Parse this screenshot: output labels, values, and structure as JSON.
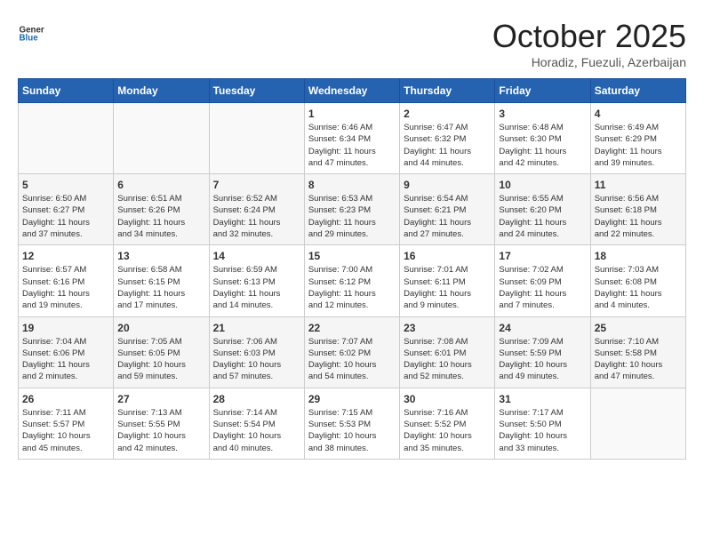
{
  "header": {
    "logo_line1": "General",
    "logo_line2": "Blue",
    "month": "October 2025",
    "location": "Horadiz, Fuezuli, Azerbaijan"
  },
  "weekdays": [
    "Sunday",
    "Monday",
    "Tuesday",
    "Wednesday",
    "Thursday",
    "Friday",
    "Saturday"
  ],
  "weeks": [
    [
      {
        "day": "",
        "info": ""
      },
      {
        "day": "",
        "info": ""
      },
      {
        "day": "",
        "info": ""
      },
      {
        "day": "1",
        "info": "Sunrise: 6:46 AM\nSunset: 6:34 PM\nDaylight: 11 hours\nand 47 minutes."
      },
      {
        "day": "2",
        "info": "Sunrise: 6:47 AM\nSunset: 6:32 PM\nDaylight: 11 hours\nand 44 minutes."
      },
      {
        "day": "3",
        "info": "Sunrise: 6:48 AM\nSunset: 6:30 PM\nDaylight: 11 hours\nand 42 minutes."
      },
      {
        "day": "4",
        "info": "Sunrise: 6:49 AM\nSunset: 6:29 PM\nDaylight: 11 hours\nand 39 minutes."
      }
    ],
    [
      {
        "day": "5",
        "info": "Sunrise: 6:50 AM\nSunset: 6:27 PM\nDaylight: 11 hours\nand 37 minutes."
      },
      {
        "day": "6",
        "info": "Sunrise: 6:51 AM\nSunset: 6:26 PM\nDaylight: 11 hours\nand 34 minutes."
      },
      {
        "day": "7",
        "info": "Sunrise: 6:52 AM\nSunset: 6:24 PM\nDaylight: 11 hours\nand 32 minutes."
      },
      {
        "day": "8",
        "info": "Sunrise: 6:53 AM\nSunset: 6:23 PM\nDaylight: 11 hours\nand 29 minutes."
      },
      {
        "day": "9",
        "info": "Sunrise: 6:54 AM\nSunset: 6:21 PM\nDaylight: 11 hours\nand 27 minutes."
      },
      {
        "day": "10",
        "info": "Sunrise: 6:55 AM\nSunset: 6:20 PM\nDaylight: 11 hours\nand 24 minutes."
      },
      {
        "day": "11",
        "info": "Sunrise: 6:56 AM\nSunset: 6:18 PM\nDaylight: 11 hours\nand 22 minutes."
      }
    ],
    [
      {
        "day": "12",
        "info": "Sunrise: 6:57 AM\nSunset: 6:16 PM\nDaylight: 11 hours\nand 19 minutes."
      },
      {
        "day": "13",
        "info": "Sunrise: 6:58 AM\nSunset: 6:15 PM\nDaylight: 11 hours\nand 17 minutes."
      },
      {
        "day": "14",
        "info": "Sunrise: 6:59 AM\nSunset: 6:13 PM\nDaylight: 11 hours\nand 14 minutes."
      },
      {
        "day": "15",
        "info": "Sunrise: 7:00 AM\nSunset: 6:12 PM\nDaylight: 11 hours\nand 12 minutes."
      },
      {
        "day": "16",
        "info": "Sunrise: 7:01 AM\nSunset: 6:11 PM\nDaylight: 11 hours\nand 9 minutes."
      },
      {
        "day": "17",
        "info": "Sunrise: 7:02 AM\nSunset: 6:09 PM\nDaylight: 11 hours\nand 7 minutes."
      },
      {
        "day": "18",
        "info": "Sunrise: 7:03 AM\nSunset: 6:08 PM\nDaylight: 11 hours\nand 4 minutes."
      }
    ],
    [
      {
        "day": "19",
        "info": "Sunrise: 7:04 AM\nSunset: 6:06 PM\nDaylight: 11 hours\nand 2 minutes."
      },
      {
        "day": "20",
        "info": "Sunrise: 7:05 AM\nSunset: 6:05 PM\nDaylight: 10 hours\nand 59 minutes."
      },
      {
        "day": "21",
        "info": "Sunrise: 7:06 AM\nSunset: 6:03 PM\nDaylight: 10 hours\nand 57 minutes."
      },
      {
        "day": "22",
        "info": "Sunrise: 7:07 AM\nSunset: 6:02 PM\nDaylight: 10 hours\nand 54 minutes."
      },
      {
        "day": "23",
        "info": "Sunrise: 7:08 AM\nSunset: 6:01 PM\nDaylight: 10 hours\nand 52 minutes."
      },
      {
        "day": "24",
        "info": "Sunrise: 7:09 AM\nSunset: 5:59 PM\nDaylight: 10 hours\nand 49 minutes."
      },
      {
        "day": "25",
        "info": "Sunrise: 7:10 AM\nSunset: 5:58 PM\nDaylight: 10 hours\nand 47 minutes."
      }
    ],
    [
      {
        "day": "26",
        "info": "Sunrise: 7:11 AM\nSunset: 5:57 PM\nDaylight: 10 hours\nand 45 minutes."
      },
      {
        "day": "27",
        "info": "Sunrise: 7:13 AM\nSunset: 5:55 PM\nDaylight: 10 hours\nand 42 minutes."
      },
      {
        "day": "28",
        "info": "Sunrise: 7:14 AM\nSunset: 5:54 PM\nDaylight: 10 hours\nand 40 minutes."
      },
      {
        "day": "29",
        "info": "Sunrise: 7:15 AM\nSunset: 5:53 PM\nDaylight: 10 hours\nand 38 minutes."
      },
      {
        "day": "30",
        "info": "Sunrise: 7:16 AM\nSunset: 5:52 PM\nDaylight: 10 hours\nand 35 minutes."
      },
      {
        "day": "31",
        "info": "Sunrise: 7:17 AM\nSunset: 5:50 PM\nDaylight: 10 hours\nand 33 minutes."
      },
      {
        "day": "",
        "info": ""
      }
    ]
  ]
}
